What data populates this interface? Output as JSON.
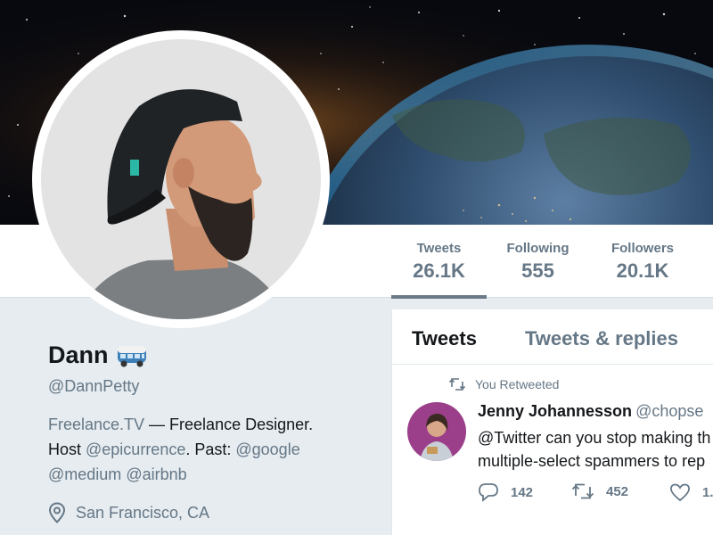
{
  "profile": {
    "name": "Dann",
    "name_emoji_icon": "bus-icon",
    "handle": "@DannPetty",
    "bio": {
      "part1": "Freelance.TV",
      "part2": " — Freelance Designer.",
      "part3": "Host ",
      "mention1": "@epicurrence",
      "part4": ". Past: ",
      "mention2": "@google",
      "mention3": "@medium",
      "mention4": "@airbnb"
    },
    "location": "San Francisco, CA"
  },
  "stats": [
    {
      "label": "Tweets",
      "value": "26.1K",
      "active": true
    },
    {
      "label": "Following",
      "value": "555",
      "active": false
    },
    {
      "label": "Followers",
      "value": "20.1K",
      "active": false
    }
  ],
  "tabs": [
    {
      "label": "Tweets",
      "active": true
    },
    {
      "label": "Tweets & replies",
      "active": false
    }
  ],
  "tweet": {
    "retweet_note": "You Retweeted",
    "author": "Jenny Johannesson",
    "handle": "@chopse",
    "text_line1": "@Twitter can you stop making th",
    "text_line2": "multiple-select spammers to rep",
    "replies": "142",
    "retweets": "452",
    "likes": "1."
  },
  "colors": {
    "secondary_text": "#657786",
    "primary_text": "#14171a",
    "background": "#e6ecf0"
  }
}
